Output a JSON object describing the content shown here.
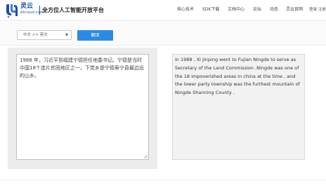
{
  "brand": {
    "name_cn": "灵云",
    "name_en": "AIcloud.com",
    "tagline": "全方位人工智能开放平台",
    "accent_color": "#1a4fa0"
  },
  "nav": {
    "items": [
      {
        "label": "核心技术"
      },
      {
        "label": "SDK下载"
      },
      {
        "label": "文档中心"
      },
      {
        "label": "论坛"
      },
      {
        "label": "动态"
      },
      {
        "label": "灵云官网"
      }
    ],
    "login": "登录",
    "register": "注册"
  },
  "toolbar": {
    "language_select": {
      "value": "中文 >> 英文"
    },
    "translate_button": {
      "label": "翻译",
      "color": "#2b8be3"
    }
  },
  "source": {
    "text": "1988 年，习近平到福建宁德担任地委书记。宁德是当时中国18个连片贫困地区之一，下党乡是宁德寿宁县最边远的山乡。"
  },
  "target": {
    "text": "in 1988 , Xi Jinping went to Fujian Ningde to serve as Secretary of the Land Commission .Ningde was one of the 18 impoverished areas in china at the time , and the lower party township was the furthest mountain of Ningde Shanning County ."
  }
}
